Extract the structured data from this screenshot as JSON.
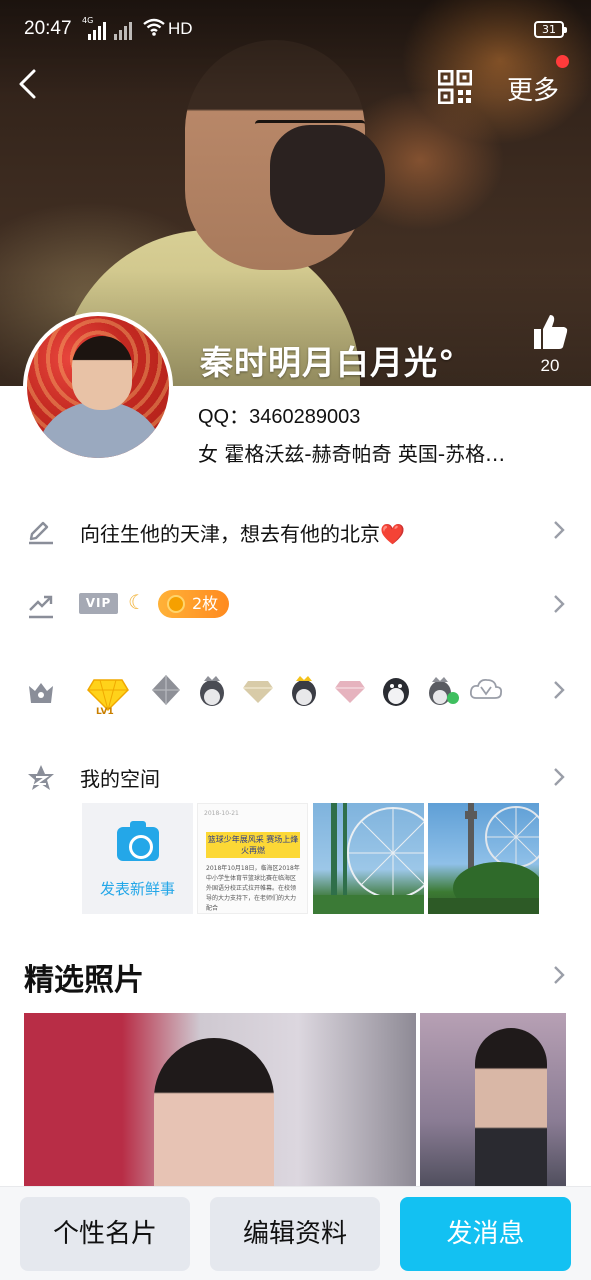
{
  "status_bar": {
    "time": "20:47",
    "network": "4G",
    "hd": "HD",
    "battery": "31"
  },
  "nav": {
    "more_label": "更多"
  },
  "profile": {
    "nickname": "秦时明月白月光°",
    "likes": "20",
    "qq": "QQ：3460289003",
    "details": "女  霍格沃兹-赫奇帕奇  英国-苏格…",
    "signature": "向往生他的天津，想去有他的北京",
    "signature_emoji": "❤️"
  },
  "vip_row": {
    "vip_label": "VIP",
    "badge_count": "2枚"
  },
  "medals": [
    "gem-lv1",
    "gray-gem",
    "penguin-crown",
    "diamond-beige",
    "penguin-crown-dark",
    "diamond-pink",
    "penguin",
    "penguin-green",
    "v-cloud"
  ],
  "medal_level": "LV1",
  "space": {
    "title": "我的空间",
    "new_post_label": "发表新鲜事",
    "doc_date": "2018-10-21",
    "doc_headline": "篮球少年展风采 赛场上烽火再燃",
    "doc_body": "2018年10月18日，临海区2018年中小学生体育节篮球比赛在临海区外国语分校正式拉开帷幕。在校领导的大力支持下，在老师们的大力配合"
  },
  "photos": {
    "title": "精选照片"
  },
  "actions": {
    "card": "个性名片",
    "edit": "编辑资料",
    "message": "发消息"
  },
  "colors": {
    "accent": "#13c1f2",
    "badge": "#ff9a28",
    "heart": "#e0202a"
  }
}
